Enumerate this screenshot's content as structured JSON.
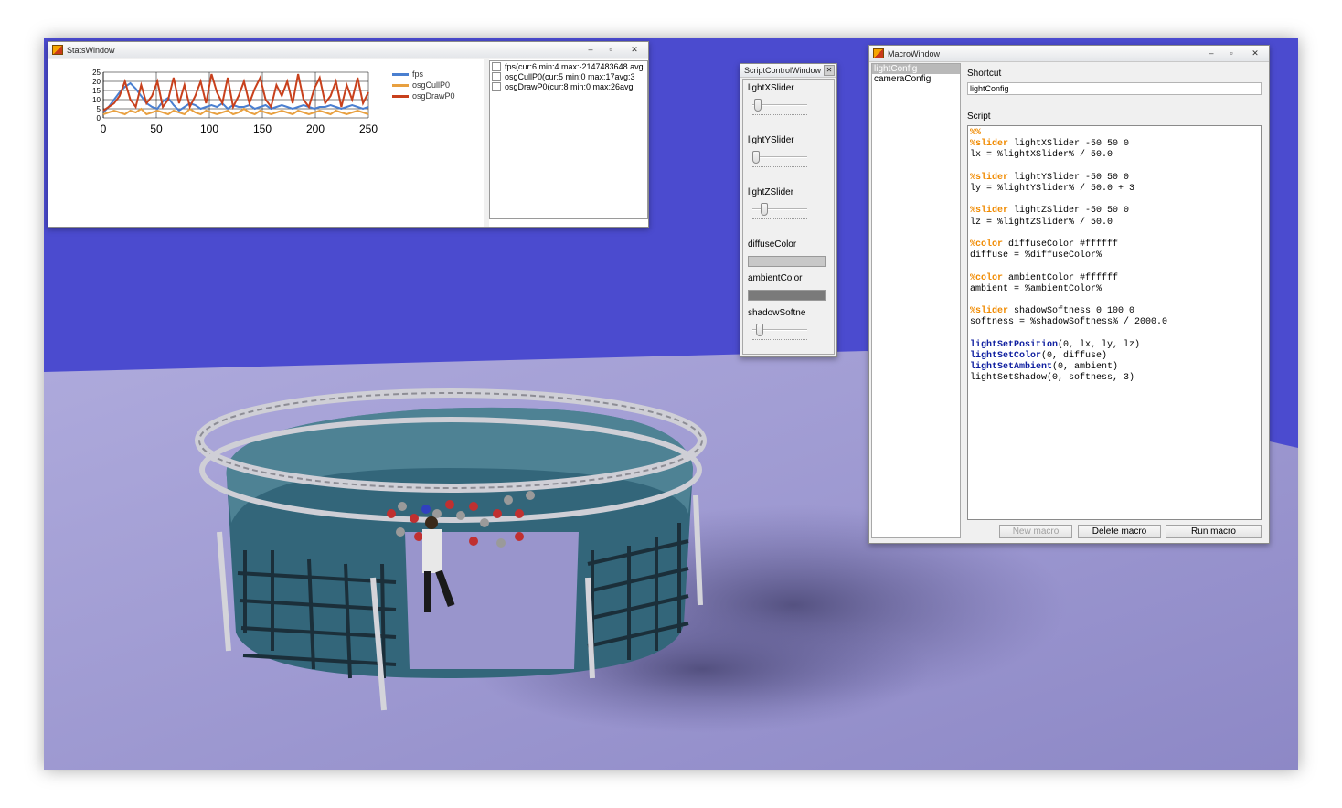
{
  "stats_window": {
    "title": "StatsWindow",
    "min": "–",
    "max": "▫",
    "close": "✕",
    "legend": [
      {
        "name": "fps",
        "color": "#4a7fd0"
      },
      {
        "name": "osgCullP0",
        "color": "#e8a040"
      },
      {
        "name": "osgDrawP0",
        "color": "#c8401c"
      }
    ],
    "stat_rows": [
      "fps(cur:6 min:4 max:-2147483648 avg",
      "osgCullP0(cur:5 min:0 max:17avg:3",
      "osgDrawP0(cur:8 min:0 max:26avg"
    ]
  },
  "chart_data": {
    "type": "line",
    "x_ticks": [
      "0",
      "50",
      "100",
      "150",
      "200",
      "250"
    ],
    "y_ticks": [
      "25",
      "20",
      "15",
      "10",
      "5",
      "0"
    ],
    "xlim": [
      0,
      250
    ],
    "ylim": [
      0,
      25
    ],
    "grid": true,
    "legend_position": "right",
    "series": [
      {
        "name": "fps",
        "color": "#4a7fd0",
        "values": [
          3,
          6,
          10,
          14,
          17,
          19,
          16,
          12,
          8,
          6,
          5,
          9,
          11,
          7,
          4,
          6,
          8,
          7,
          5,
          6,
          7,
          6,
          8,
          5,
          7,
          6,
          6,
          7,
          5,
          6,
          7,
          5,
          6,
          7,
          6,
          5,
          6,
          7,
          6,
          5,
          6,
          6,
          7,
          6,
          5,
          6,
          7,
          6,
          5,
          6
        ]
      },
      {
        "name": "osgCullP0",
        "color": "#e8a040",
        "values": [
          2,
          3,
          4,
          3,
          2,
          4,
          3,
          5,
          2,
          3,
          4,
          3,
          2,
          4,
          3,
          2,
          5,
          3,
          2,
          4,
          3,
          2,
          3,
          4,
          2,
          3,
          5,
          3,
          2,
          4,
          3,
          2,
          3,
          4,
          3,
          2,
          4,
          3,
          2,
          3,
          4,
          3,
          2,
          4,
          3,
          2,
          3,
          4,
          3,
          2
        ]
      },
      {
        "name": "osgDrawP0",
        "color": "#c8401c",
        "values": [
          4,
          6,
          8,
          12,
          20,
          10,
          6,
          18,
          8,
          12,
          20,
          6,
          10,
          22,
          8,
          18,
          6,
          12,
          20,
          8,
          24,
          14,
          8,
          22,
          6,
          12,
          20,
          8,
          16,
          22,
          10,
          6,
          18,
          12,
          20,
          8,
          24,
          10,
          6,
          16,
          22,
          8,
          12,
          20,
          6,
          18,
          10,
          22,
          8,
          14
        ]
      }
    ]
  },
  "script_control": {
    "title": "ScriptControlWindow",
    "close": "✕",
    "sliders": [
      {
        "label": "lightXSlider",
        "value": 0.04
      },
      {
        "label": "lightYSlider",
        "value": 0.0
      },
      {
        "label": "lightZSlider",
        "value": 0.17
      },
      {
        "label": "shadowSoftne",
        "value": 0.08
      }
    ],
    "colors": [
      {
        "label": "diffuseColor",
        "color": "#c8c8c8"
      },
      {
        "label": "ambientColor",
        "color": "#7a7a7a"
      }
    ]
  },
  "macro_window": {
    "title": "MacroWindow",
    "min": "–",
    "max": "▫",
    "close": "✕",
    "macros": [
      "lightConfig",
      "cameraConfig"
    ],
    "selected": "lightConfig",
    "shortcut_label": "Shortcut",
    "shortcut_value": "lightConfig",
    "script_label": "Script",
    "script_lines": [
      [
        {
          "t": "%%",
          "k": "kw"
        }
      ],
      [
        {
          "t": "%slider",
          "k": "kw"
        },
        {
          "t": " lightXSlider -50 50 0",
          "k": ""
        }
      ],
      [
        {
          "t": "lx = %lightXSlider% / 50.0",
          "k": ""
        }
      ],
      [
        {
          "t": "",
          "k": ""
        }
      ],
      [
        {
          "t": "%slider",
          "k": "kw"
        },
        {
          "t": " lightYSlider -50 50 0",
          "k": ""
        }
      ],
      [
        {
          "t": "ly = %lightYSlider% / 50.0 + 3",
          "k": ""
        }
      ],
      [
        {
          "t": "",
          "k": ""
        }
      ],
      [
        {
          "t": "%slider",
          "k": "kw"
        },
        {
          "t": " lightZSlider -50 50 0",
          "k": ""
        }
      ],
      [
        {
          "t": "lz = %lightZSlider% / 50.0",
          "k": ""
        }
      ],
      [
        {
          "t": "",
          "k": ""
        }
      ],
      [
        {
          "t": "%color",
          "k": "kw"
        },
        {
          "t": " diffuseColor #ffffff",
          "k": ""
        }
      ],
      [
        {
          "t": "diffuse = %diffuseColor%",
          "k": ""
        }
      ],
      [
        {
          "t": "",
          "k": ""
        }
      ],
      [
        {
          "t": "%color",
          "k": "kw"
        },
        {
          "t": " ambientColor #ffffff",
          "k": ""
        }
      ],
      [
        {
          "t": "ambient = %ambientColor%",
          "k": ""
        }
      ],
      [
        {
          "t": "",
          "k": ""
        }
      ],
      [
        {
          "t": "%slider",
          "k": "kw"
        },
        {
          "t": " shadowSoftness 0 100 0",
          "k": ""
        }
      ],
      [
        {
          "t": "softness = %shadowSoftness% / 2000.0",
          "k": ""
        }
      ],
      [
        {
          "t": "",
          "k": ""
        }
      ],
      [
        {
          "t": "lightSetPosition",
          "k": "fn"
        },
        {
          "t": "(0, lx, ly, lz)",
          "k": ""
        }
      ],
      [
        {
          "t": "lightSetColor",
          "k": "fn"
        },
        {
          "t": "(0, diffuse)",
          "k": ""
        }
      ],
      [
        {
          "t": "lightSetAmbient",
          "k": "fn"
        },
        {
          "t": "(0, ambient)",
          "k": ""
        }
      ],
      [
        {
          "t": "lightSetShadow(0, softness, 3)",
          "k": ""
        }
      ]
    ],
    "buttons": {
      "new": "New macro",
      "delete": "Delete macro",
      "run": "Run macro"
    }
  },
  "scene_colors": {
    "wall": "#4b4bcf",
    "floor": "#a7a3d6"
  }
}
